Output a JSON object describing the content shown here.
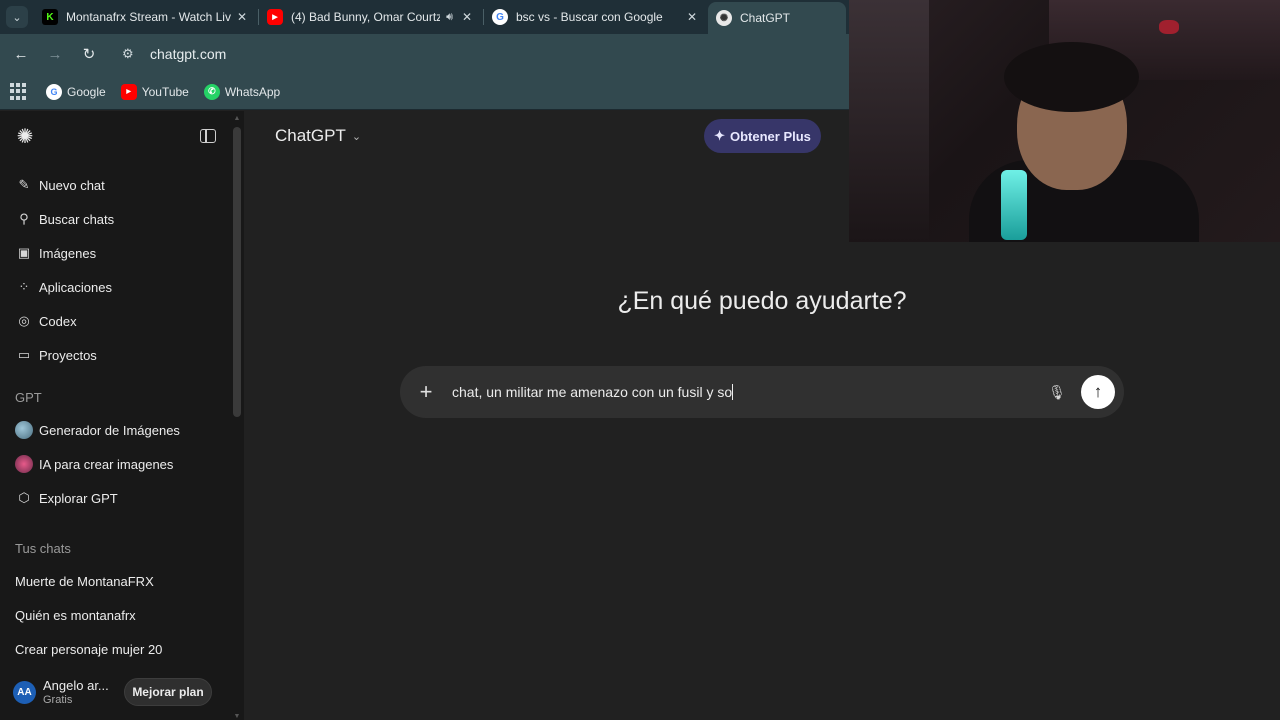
{
  "browser": {
    "tabs": [
      {
        "title": "Montanafrx Stream - Watch Liv",
        "favicon": "kick-icon",
        "color": "#53fc18",
        "audio": false
      },
      {
        "title": "(4) Bad Bunny, Omar Courtz",
        "favicon": "youtube-icon",
        "color": "#ff0000",
        "audio": true
      },
      {
        "title": "bsc vs - Buscar con Google",
        "favicon": "google-icon",
        "color": "#4285f4",
        "audio": false
      },
      {
        "title": "ChatGPT",
        "favicon": "chatgpt-icon",
        "color": "#ffffff",
        "audio": false,
        "active": true
      }
    ],
    "url": "chatgpt.com",
    "bookmarks": [
      {
        "label": "Google",
        "icon": "google-icon"
      },
      {
        "label": "YouTube",
        "icon": "youtube-icon"
      },
      {
        "label": "WhatsApp",
        "icon": "whatsapp-icon"
      }
    ]
  },
  "sidebar": {
    "nav": [
      {
        "label": "Nuevo chat",
        "icon": "new-chat-icon"
      },
      {
        "label": "Buscar chats",
        "icon": "search-icon"
      },
      {
        "label": "Imágenes",
        "icon": "images-icon"
      },
      {
        "label": "Aplicaciones",
        "icon": "apps-icon"
      },
      {
        "label": "Codex",
        "icon": "codex-icon"
      },
      {
        "label": "Proyectos",
        "icon": "folder-icon"
      }
    ],
    "gpt_section": "GPT",
    "gpts": [
      {
        "label": "Generador de Imágenes",
        "icon": "image-generator-icon"
      },
      {
        "label": "IA para crear imagenes",
        "icon": "ai-images-icon"
      },
      {
        "label": "Explorar GPT",
        "icon": "explore-gpt-icon"
      }
    ],
    "chats_section": "Tus chats",
    "chats": [
      "Muerte de MontanaFRX",
      "Quién es montanafrx",
      "Crear personaje mujer 20"
    ],
    "user": {
      "initials": "AA",
      "name": "Angelo ar...",
      "plan": "Gratis",
      "upgrade": "Mejorar plan"
    }
  },
  "main": {
    "model": "ChatGPT",
    "plus_button": "Obtener Plus",
    "heading": "¿En qué puedo ayudarte?",
    "composer_text": "chat, un militar me amenazo con un fusil y so"
  },
  "colors": {
    "accent_plus": "#373669",
    "sidebar_bg": "#181818",
    "main_bg": "#212121",
    "composer_bg": "#303030"
  }
}
